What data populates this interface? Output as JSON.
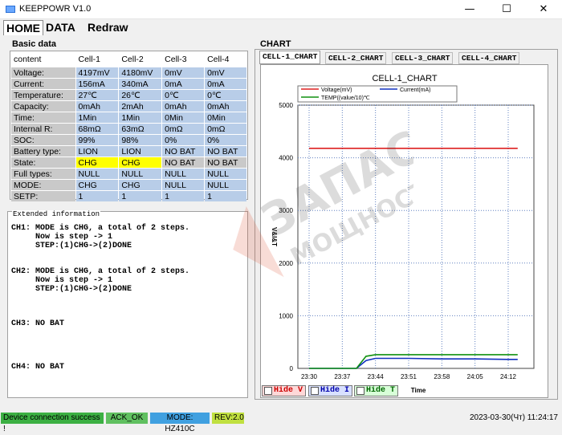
{
  "app": {
    "title": "KEEPPOWR V1.0",
    "minimize": "—",
    "maximize": "☐",
    "close": "✕"
  },
  "menu": {
    "tabs": [
      "HOME",
      "DATA",
      "Redraw"
    ]
  },
  "basic": {
    "title": "Basic data",
    "headers": [
      "content",
      "Cell-1",
      "Cell-2",
      "Cell-3",
      "Cell-4"
    ],
    "rows": [
      [
        "Voltage:",
        "4197mV",
        "4180mV",
        "0mV",
        "0mV"
      ],
      [
        "Current:",
        "156mA",
        "340mA",
        "0mA",
        "0mA"
      ],
      [
        "Temperature:",
        "27℃",
        "26℃",
        "0℃",
        "0℃"
      ],
      [
        "Capacity:",
        "0mAh",
        "2mAh",
        "0mAh",
        "0mAh"
      ],
      [
        "Time:",
        "1Min",
        "1Min",
        "0Min",
        "0Min"
      ],
      [
        "Internal R:",
        "68mΩ",
        "63mΩ",
        "0mΩ",
        "0mΩ"
      ],
      [
        "SOC:",
        "99%",
        "98%",
        "0%",
        "0%"
      ],
      [
        "Battery type:",
        "LION",
        "LION",
        "NO BAT",
        "NO BAT"
      ],
      [
        "State:",
        "CHG",
        "CHG",
        "NO BAT",
        "NO BAT"
      ],
      [
        "Full types:",
        "NULL",
        "NULL",
        "NULL",
        "NULL"
      ],
      [
        "MODE:",
        "CHG",
        "CHG",
        "NULL",
        "NULL"
      ],
      [
        "SETP:",
        "1",
        "1",
        "1",
        "1"
      ]
    ]
  },
  "extended": {
    "title": "Extended information",
    "text": "CH1: MODE is CHG, a total of 2 steps.\n     Now is step -> 1\n     STEP:(1)CHG->(2)DONE\n\n\nCH2: MODE is CHG, a total of 2 steps.\n     Now is step -> 1\n     STEP:(1)CHG->(2)DONE\n\n\n\nCH3: NO BAT\n\n\n\n\nCH4: NO BAT"
  },
  "chart": {
    "group_title": "CHART",
    "tabs": [
      "CELL-1_CHART",
      "CELL-2_CHART",
      "CELL-3_CHART",
      "CELL-4_CHART"
    ],
    "buttons": [
      "Hide V",
      "Hide I",
      "Hide T"
    ]
  },
  "chart_data": {
    "type": "line",
    "title": "CELL-1_CHART",
    "xlabel": "Time",
    "ylabel": "V&I&T",
    "ylim": [
      0,
      5000
    ],
    "yticks": [
      "0",
      "1000",
      "2000",
      "3000",
      "4000",
      "5000"
    ],
    "xticks": [
      "23:30",
      "23:37",
      "23:44",
      "23:51",
      "23:58",
      "24:05",
      "24:12"
    ],
    "grid": true,
    "legend": "top-left",
    "x": [
      "23:30",
      "23:37",
      "23:40",
      "23:42",
      "23:44",
      "23:51",
      "23:58",
      "24:05",
      "24:12",
      "24:14"
    ],
    "series": [
      {
        "name": "Voltage(mV)",
        "color": "#dd2020",
        "values": [
          4180,
          4180,
          4180,
          4180,
          4180,
          4180,
          4180,
          4180,
          4180,
          4180
        ]
      },
      {
        "name": "Current(mA)",
        "color": "#1030c0",
        "values": [
          0,
          0,
          0,
          150,
          190,
          190,
          180,
          180,
          170,
          170
        ]
      },
      {
        "name": "TEMP((value/10)℃",
        "color": "#109010",
        "values": [
          0,
          0,
          0,
          230,
          260,
          260,
          260,
          260,
          260,
          260
        ]
      }
    ]
  },
  "status": {
    "connection": "Device connection success !",
    "ack": "ACK_OK",
    "mode": "MODE: HZ410C",
    "rev": "REV:2.0",
    "datetime": "2023-03-30(Чт) 11:24:17"
  },
  "colors": {
    "connection": "#3cb043",
    "ack": "#60c060",
    "mode": "#40a0e0",
    "rev": "#c0e040"
  }
}
